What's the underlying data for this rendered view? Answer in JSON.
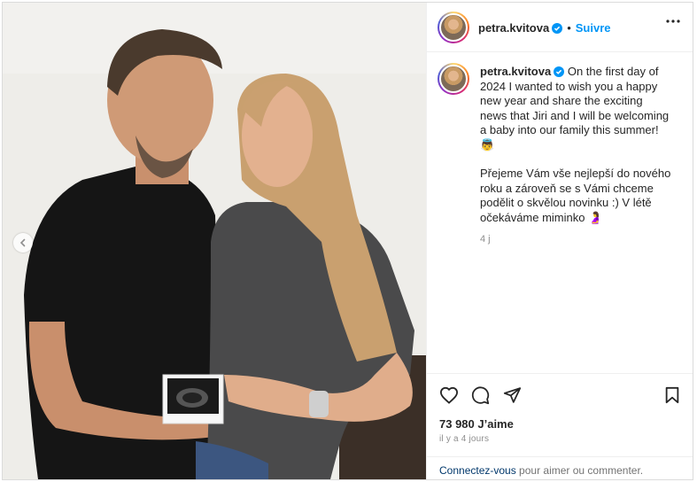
{
  "post": {
    "username": "petra.kvitova",
    "separator": "•",
    "follow_label": "Suivre",
    "caption_en": "On the first day of 2024 I wanted to wish you a happy new year and share the exciting news that Jiri and I will be welcoming a baby into our family this summer! 👼",
    "caption_cz": "Přejeme Vám vše nejlepší do nového roku a zároveň se s Vámi chceme podělit o skvělou novinku :) V létě očekáváme miminko 🤰",
    "caption_time": "4 j",
    "likes": "73 980 J’aime",
    "posted_ago": "il y a 4 jours",
    "login_link": "Connectez-vous",
    "login_rest": " pour aimer ou commenter."
  },
  "icons": {
    "verified": "verified-badge-icon",
    "more": "more-options-icon",
    "like": "heart-icon",
    "comment": "comment-icon",
    "share": "share-icon",
    "save": "bookmark-icon",
    "prev": "chevron-left-icon"
  },
  "colors": {
    "accent": "#0095f6",
    "link": "#00376b",
    "muted": "#8e8e8e",
    "border": "#dbdbdb"
  }
}
